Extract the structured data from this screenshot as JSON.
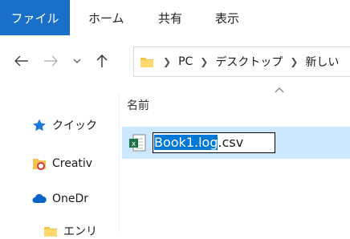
{
  "ribbon": {
    "tabs": [
      {
        "label": "ファイル",
        "active": true
      },
      {
        "label": "ホーム"
      },
      {
        "label": "共有"
      },
      {
        "label": "表示"
      }
    ]
  },
  "address": {
    "breadcrumb": [
      "PC",
      "デスクトップ",
      "新しい"
    ]
  },
  "sidebar": {
    "items": [
      {
        "label": "クイック",
        "icon": "star-icon"
      },
      {
        "label": "Creativ",
        "icon": "creative-cloud-folder-icon"
      },
      {
        "label": "OneDr",
        "icon": "onedrive-cloud-icon"
      },
      {
        "label": "エンリ",
        "icon": "folder-icon"
      }
    ]
  },
  "list": {
    "column_header": "名前",
    "rename": {
      "selected_text": "Book1.log",
      "rest_text": ".csv"
    }
  },
  "colors": {
    "accent": "#1a6fc9",
    "selection_row": "#cce8ff",
    "text_selection": "#0078d7"
  }
}
